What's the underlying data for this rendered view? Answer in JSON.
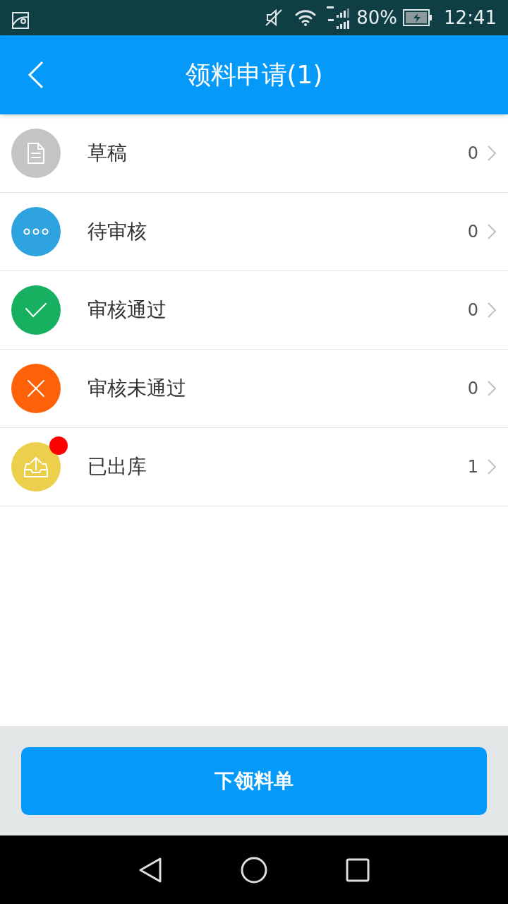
{
  "status_bar": {
    "battery": "80%",
    "time": "12:41"
  },
  "header": {
    "title": "领料申请(1)"
  },
  "items": [
    {
      "kind": "draft",
      "label": "草稿",
      "count": "0",
      "color": "#c4c4c4",
      "badge": false
    },
    {
      "kind": "pending",
      "label": "待审核",
      "count": "0",
      "color": "#2fa3e0",
      "badge": false
    },
    {
      "kind": "approved",
      "label": "审核通过",
      "count": "0",
      "color": "#16b060",
      "badge": false
    },
    {
      "kind": "rejected",
      "label": "审核未通过",
      "count": "0",
      "color": "#ff6109",
      "badge": false
    },
    {
      "kind": "shipped",
      "label": "已出库",
      "count": "1",
      "color": "#ecd04c",
      "badge": true
    }
  ],
  "footer_button": "下领料单"
}
